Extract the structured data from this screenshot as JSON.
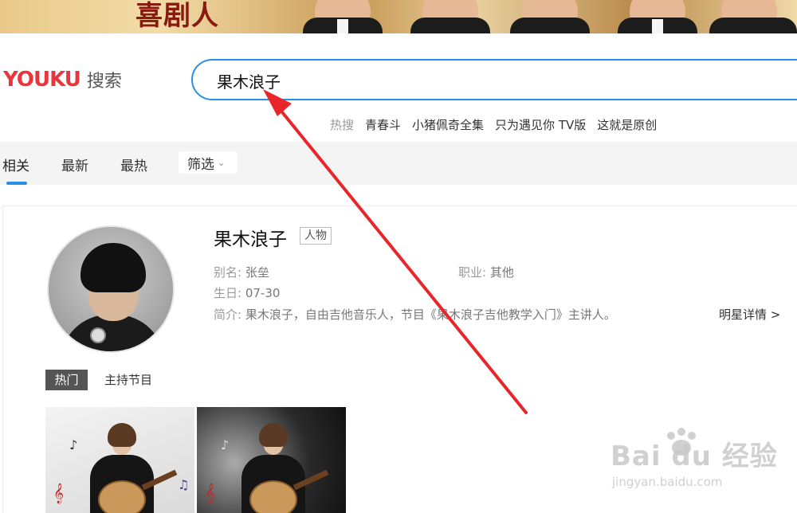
{
  "banner": {
    "brand": "喜剧人"
  },
  "header": {
    "logo_text": "YOUKU",
    "logo_suffix": "搜索",
    "search_value": "果木浪子"
  },
  "hot_search": {
    "label": "热搜",
    "items": [
      "青春斗",
      "小猪佩奇全集",
      "只为遇见你 TV版",
      "这就是原创"
    ]
  },
  "tabs": {
    "items": [
      "相关",
      "最新",
      "最热"
    ],
    "filter_label": "筛选"
  },
  "person": {
    "name": "果木浪子",
    "tag": "人物",
    "alias_label": "别名:",
    "alias_value": "张垒",
    "job_label": "职业:",
    "job_value": "其他",
    "birthday_label": "生日:",
    "birthday_value": "07-30",
    "intro_label": "简介:",
    "intro_value": "果木浪子，自由吉他音乐人，节目《果木浪子吉他教学入门》主讲人。",
    "detail_link": "明星详情 >"
  },
  "sub_tabs": [
    "热门",
    "主持节目"
  ],
  "watermark": {
    "big": "Bai du 经验",
    "small": "jingyan.baidu.com"
  },
  "colors": {
    "accent_blue": "#2a8fe8",
    "annotation_red": "#e8262a"
  }
}
